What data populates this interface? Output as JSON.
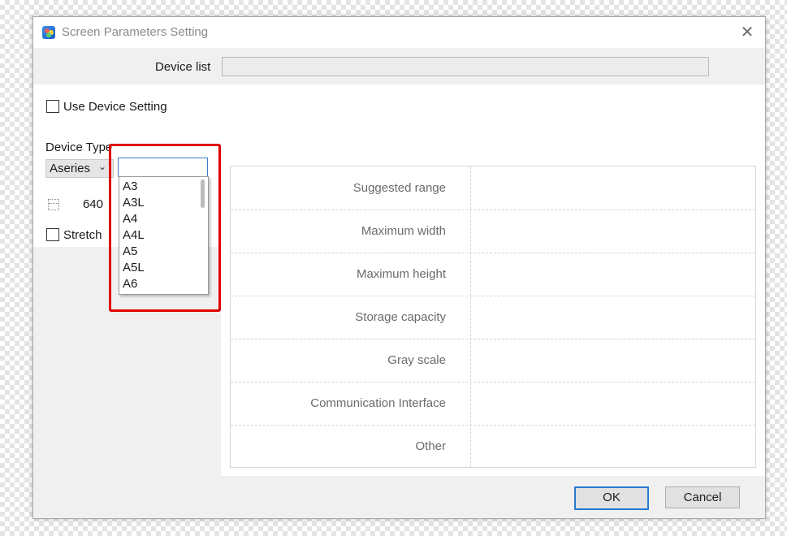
{
  "window": {
    "title": "Screen Parameters Setting"
  },
  "device_list": {
    "label": "Device list",
    "value": ""
  },
  "use_device_setting": {
    "label": "Use Device Setting",
    "checked": false
  },
  "device_type": {
    "label": "Device Type",
    "series_value": "Aseries",
    "model_value": "",
    "options": [
      "A3",
      "A3L",
      "A4",
      "A4L",
      "A5",
      "A5L",
      "A6"
    ]
  },
  "size": {
    "width_value": "640"
  },
  "stretch": {
    "label": "Stretch",
    "checked": false
  },
  "parameters": {
    "rows": [
      {
        "label": "Suggested range",
        "value": ""
      },
      {
        "label": "Maximum width",
        "value": ""
      },
      {
        "label": "Maximum height",
        "value": ""
      },
      {
        "label": "Storage capacity",
        "value": ""
      },
      {
        "label": "Gray scale",
        "value": ""
      },
      {
        "label": "Communication Interface",
        "value": ""
      },
      {
        "label": "Other",
        "value": ""
      }
    ]
  },
  "buttons": {
    "ok_label": "OK",
    "cancel_label": "Cancel"
  },
  "icons": {
    "app": "app-icon",
    "close": "close-icon",
    "dropdown": "chevron-down-icon"
  },
  "colors": {
    "accent": "#2a78d1",
    "highlight": "#e00000"
  }
}
